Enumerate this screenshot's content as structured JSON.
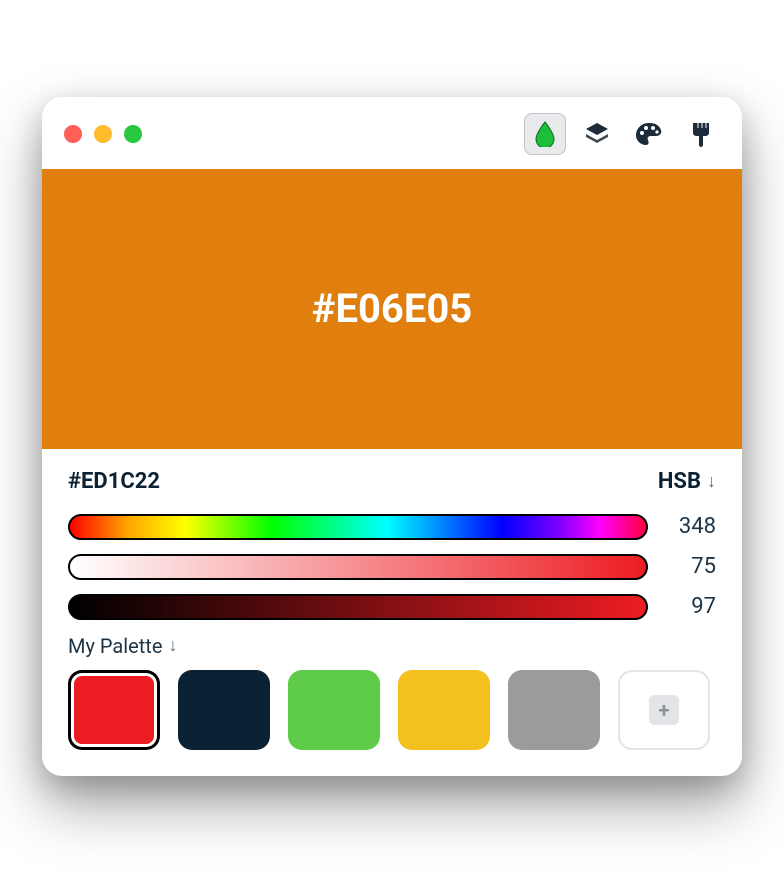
{
  "preview": {
    "hex_label": "#E06E05",
    "bg_color": "#E07E0E"
  },
  "current": {
    "hex": "#ED1C22",
    "mode": "HSB"
  },
  "sliders": {
    "hue": 348,
    "saturation": 75,
    "brightness": 97
  },
  "palette": {
    "label": "My Palette",
    "items": [
      {
        "color": "#ED1C22",
        "selected": true
      },
      {
        "color": "#0B2234",
        "selected": false
      },
      {
        "color": "#5ECC49",
        "selected": false
      },
      {
        "color": "#F4C01E",
        "selected": false
      },
      {
        "color": "#9B9B9B",
        "selected": false
      }
    ]
  },
  "icons": {
    "drop_active_color": "#1DBF3A"
  }
}
